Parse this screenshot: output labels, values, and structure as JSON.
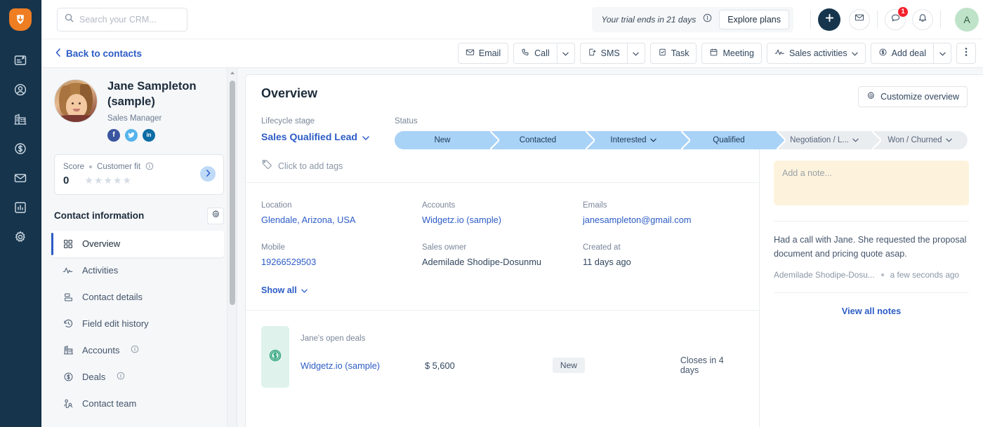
{
  "rail": {
    "logo_icon": "freshworks-logo-icon",
    "items": [
      {
        "icon": "dashboard-icon",
        "name": "dashboard"
      },
      {
        "icon": "contacts-icon",
        "name": "contacts"
      },
      {
        "icon": "accounts-building-icon",
        "name": "accounts"
      },
      {
        "icon": "deals-dollar-icon",
        "name": "deals"
      },
      {
        "icon": "mail-icon",
        "name": "email"
      },
      {
        "icon": "reports-bar-chart-icon",
        "name": "reports"
      },
      {
        "icon": "settings-gear-icon",
        "name": "settings"
      }
    ]
  },
  "topbar": {
    "search_placeholder": "Search your CRM...",
    "search_value": "",
    "search_icon": "search-icon",
    "trial_text": "Your trial ends in 21 days",
    "trial_info_icon": "info-icon",
    "explore_label": "Explore plans",
    "plus_icon": "plus-icon",
    "mail_icon": "envelope-icon",
    "chat_icon": "chat-icon",
    "chat_badge": "1",
    "bell_icon": "bell-icon",
    "avatar_initial": "A"
  },
  "actionbar": {
    "back_label": "Back to contacts",
    "back_icon": "chevron-left-icon",
    "buttons": [
      {
        "label": "Email",
        "icon": "envelope-icon",
        "caret": false
      },
      {
        "label": "Call",
        "icon": "phone-icon",
        "caret": true
      },
      {
        "label": "SMS",
        "icon": "sms-icon",
        "caret": true
      },
      {
        "label": "Task",
        "icon": "task-check-icon",
        "caret": false
      },
      {
        "label": "Meeting",
        "icon": "calendar-icon",
        "caret": false
      },
      {
        "label": "Sales activities",
        "icon": "activity-pulse-icon",
        "caret": true,
        "inline_caret": true
      },
      {
        "label": "Add deal",
        "icon": "deals-dollar-icon",
        "caret": true
      }
    ],
    "kebab_icon": "kebab-menu-icon"
  },
  "contact": {
    "name": "Jane Sampleton (sample)",
    "job_title": "Sales Manager",
    "avatar_name": "contact-avatar",
    "socials": [
      {
        "name": "facebook-icon",
        "glyph": "f",
        "color": "#3a559f"
      },
      {
        "name": "twitter-icon",
        "glyph": "t",
        "color": "#54b3ec"
      },
      {
        "name": "linkedin-icon",
        "glyph": "in",
        "color": "#0d6ca4"
      }
    ],
    "score_label": "Score",
    "customer_fit_label": "Customer fit",
    "customer_fit_info_icon": "info-icon",
    "score_value": "0",
    "stars": 5,
    "arrow_icon": "chevron-right-icon",
    "info_title": "Contact information",
    "gear_icon": "gear-icon",
    "nav": [
      {
        "label": "Overview",
        "icon": "grid-squares-icon",
        "active": true
      },
      {
        "label": "Activities",
        "icon": "activity-pulse-icon",
        "active": false
      },
      {
        "label": "Contact details",
        "icon": "contact-card-icon",
        "active": false
      },
      {
        "label": "Field edit history",
        "icon": "history-clock-icon",
        "active": false
      },
      {
        "label": "Accounts",
        "icon": "accounts-building-icon",
        "active": false,
        "info": true
      },
      {
        "label": "Deals",
        "icon": "deals-dollar-icon",
        "active": false,
        "info": true
      },
      {
        "label": "Contact team",
        "icon": "team-people-icon",
        "active": false
      }
    ]
  },
  "overview": {
    "title": "Overview",
    "customize_label": "Customize overview",
    "customize_icon": "gear-icon",
    "lifecycle_label": "Lifecycle stage",
    "lifecycle_value": "Sales Qualified Lead",
    "lifecycle_caret_icon": "chevron-down-icon",
    "status_label": "Status",
    "pipeline": [
      {
        "label": "New",
        "state": "done",
        "caret": false
      },
      {
        "label": "Contacted",
        "state": "done",
        "caret": false
      },
      {
        "label": "Interested",
        "state": "done",
        "caret": true
      },
      {
        "label": "Qualified",
        "state": "done",
        "caret": false
      },
      {
        "label": "Negotiation / L...",
        "state": "todo",
        "caret": true
      },
      {
        "label": "Won / Churned",
        "state": "todo",
        "caret": true
      }
    ],
    "tags_label": "Click to add tags",
    "tags_icon": "tag-icon",
    "fields_row1": [
      {
        "key": "Location",
        "value": "Glendale, Arizona, USA",
        "link": true
      },
      {
        "key": "Accounts",
        "value": "Widgetz.io (sample)",
        "link": true
      },
      {
        "key": "Emails",
        "value": "janesampleton@gmail.com",
        "link": true
      }
    ],
    "fields_row2": [
      {
        "key": "Mobile",
        "value": "19266529503",
        "link": true
      },
      {
        "key": "Sales owner",
        "value": "Ademilade Shodipe-Dosunmu",
        "link": false
      },
      {
        "key": "Created at",
        "value": "11 days ago",
        "link": false
      }
    ],
    "show_all_label": "Show all",
    "show_all_icon": "chevron-down-icon",
    "deals_header": "Jane's open deals",
    "deals_icon": "deals-dollar-icon",
    "deals": [
      {
        "name": "Widgetz.io (sample)",
        "amount": "$ 5,600",
        "stage": "New",
        "close": "Closes in 4 days"
      }
    ]
  },
  "notes": {
    "placeholder": "Add a note...",
    "value": "",
    "entries": [
      {
        "text": "Had a call with Jane. She requested the proposal document and pricing quote asap.",
        "author": "Ademilade Shodipe-Dosu...",
        "time": "a few seconds ago"
      }
    ],
    "view_all_label": "View all notes"
  },
  "colors": {
    "brand_orange": "#ef7d22",
    "rail_navy": "#16354d",
    "link_blue": "#2c5cc5",
    "pipeline_active": "#a9d2f7",
    "pipeline_inactive": "#eaedf0",
    "badge_red": "#f5222d",
    "note_yellow": "#fdf3dd",
    "deal_green": "#dff3ec"
  }
}
